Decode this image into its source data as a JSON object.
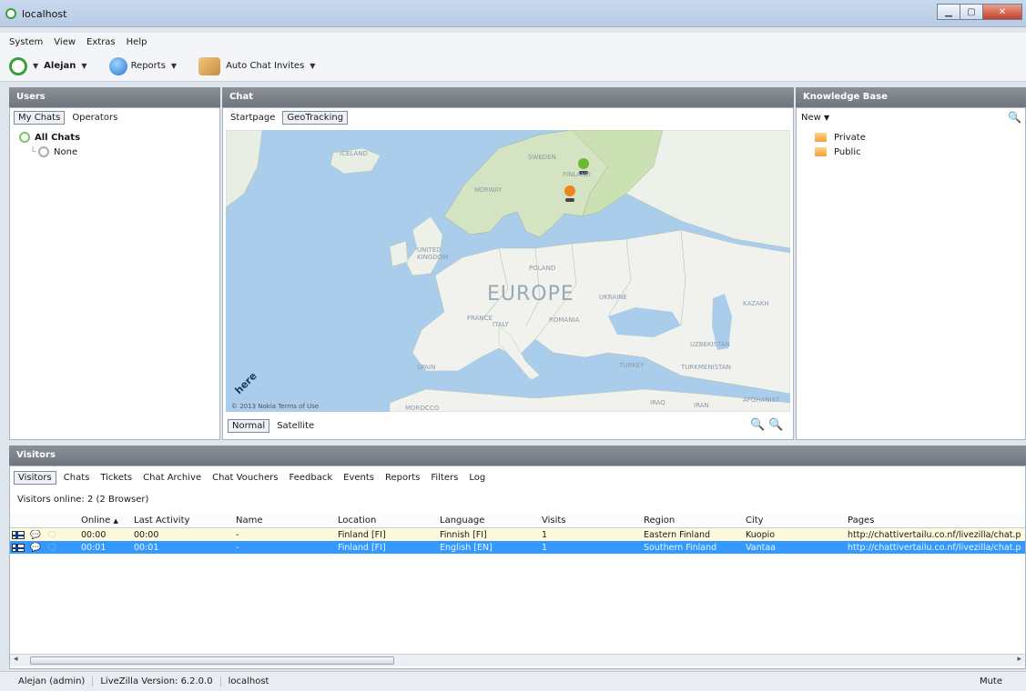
{
  "window": {
    "title": "localhost"
  },
  "menu": [
    "System",
    "View",
    "Extras",
    "Help"
  ],
  "toolbar": {
    "user": "Alejan",
    "reports": "Reports",
    "invites": "Auto Chat Invites"
  },
  "users_panel": {
    "header": "Users",
    "tabs": [
      "My Chats",
      "Operators"
    ],
    "tree": [
      {
        "label": "All Chats"
      },
      {
        "label": "None"
      }
    ]
  },
  "chat_panel": {
    "header": "Chat",
    "tabs": [
      "Startpage",
      "GeoTracking"
    ],
    "map_labels": [
      "ICELAND",
      "SWEDEN",
      "FINLAND",
      "NORWAY",
      "UNITED KINGDOM",
      "POLAND",
      "EUROPE",
      "UKRAINE",
      "KAZAKH",
      "FRANCE",
      "ITALY",
      "ROMANIA",
      "UZBEKISTAN",
      "SPAIN",
      "TURKEY",
      "TURKMENISTAN",
      "MOROCCO",
      "IRAQ",
      "IRAN",
      "AFGHANIST"
    ],
    "map_credit": "© 2013 Nokia  Terms of Use",
    "map_logo": "here",
    "map_modes": [
      "Normal",
      "Satellite"
    ]
  },
  "kb_panel": {
    "header": "Knowledge Base",
    "new_label": "New",
    "folders": [
      "Private",
      "Public"
    ]
  },
  "visitors_panel": {
    "header": "Visitors",
    "tabs": [
      "Visitors",
      "Chats",
      "Tickets",
      "Chat Archive",
      "Chat Vouchers",
      "Feedback",
      "Events",
      "Reports",
      "Filters",
      "Log"
    ],
    "online_info": "Visitors online: 2 (2 Browser)",
    "columns": [
      "Online",
      "Last Activity",
      "Name",
      "Location",
      "Language",
      "Visits",
      "Region",
      "City",
      "Pages"
    ],
    "rows": [
      [
        "00:00",
        "00:00",
        "-",
        "Finland [FI]",
        "Finnish [FI]",
        "1",
        "Eastern Finland",
        "Kuopio",
        "http://chattivertailu.co.nf/livezilla/chat.php"
      ],
      [
        "00:01",
        "00:01",
        "-",
        "Finland [FI]",
        "English [EN]",
        "1",
        "Southern Finland",
        "Vantaa",
        "http://chattivertailu.co.nf/livezilla/chat.php"
      ]
    ]
  },
  "statusbar": {
    "user": "Alejan (admin)",
    "version": "LiveZilla Version: 6.2.0.0",
    "host": "localhost",
    "mute": "Mute"
  }
}
